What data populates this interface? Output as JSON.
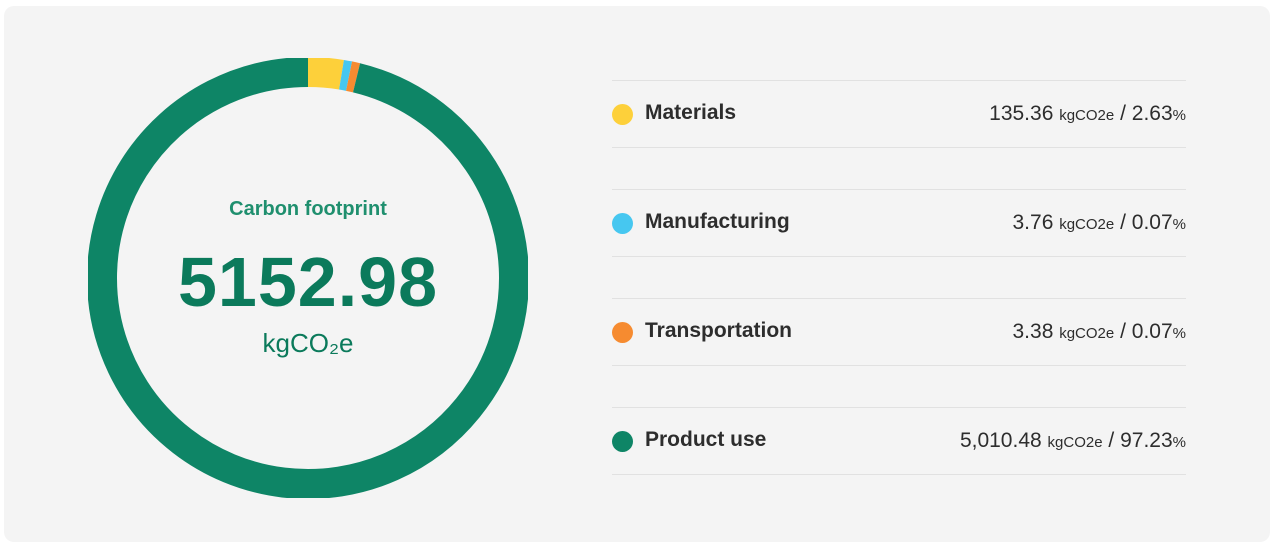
{
  "chart_data": {
    "type": "pie",
    "style": "donut",
    "title": "Carbon footprint",
    "total": "5152.98",
    "total_unit": "kgCO₂e",
    "unit": "kgCO2e",
    "legend_position": "right",
    "segments": [
      {
        "name": "Materials",
        "value": 135.36,
        "value_label": "135.36",
        "percent": 2.63,
        "percent_label": "2.63",
        "color": "#fdd03a"
      },
      {
        "name": "Manufacturing",
        "value": 3.76,
        "value_label": "3.76",
        "percent": 0.07,
        "percent_label": "0.07",
        "color": "#46c7f0"
      },
      {
        "name": "Transportation",
        "value": 3.38,
        "value_label": "3.38",
        "percent": 0.07,
        "percent_label": "0.07",
        "color": "#f68b30"
      },
      {
        "name": "Product use",
        "value": 5010.48,
        "value_label": "5,010.48",
        "percent": 97.23,
        "percent_label": "97.23",
        "color": "#0e8566"
      }
    ]
  },
  "labels": {
    "separator": "/",
    "percent_sign": "%"
  }
}
